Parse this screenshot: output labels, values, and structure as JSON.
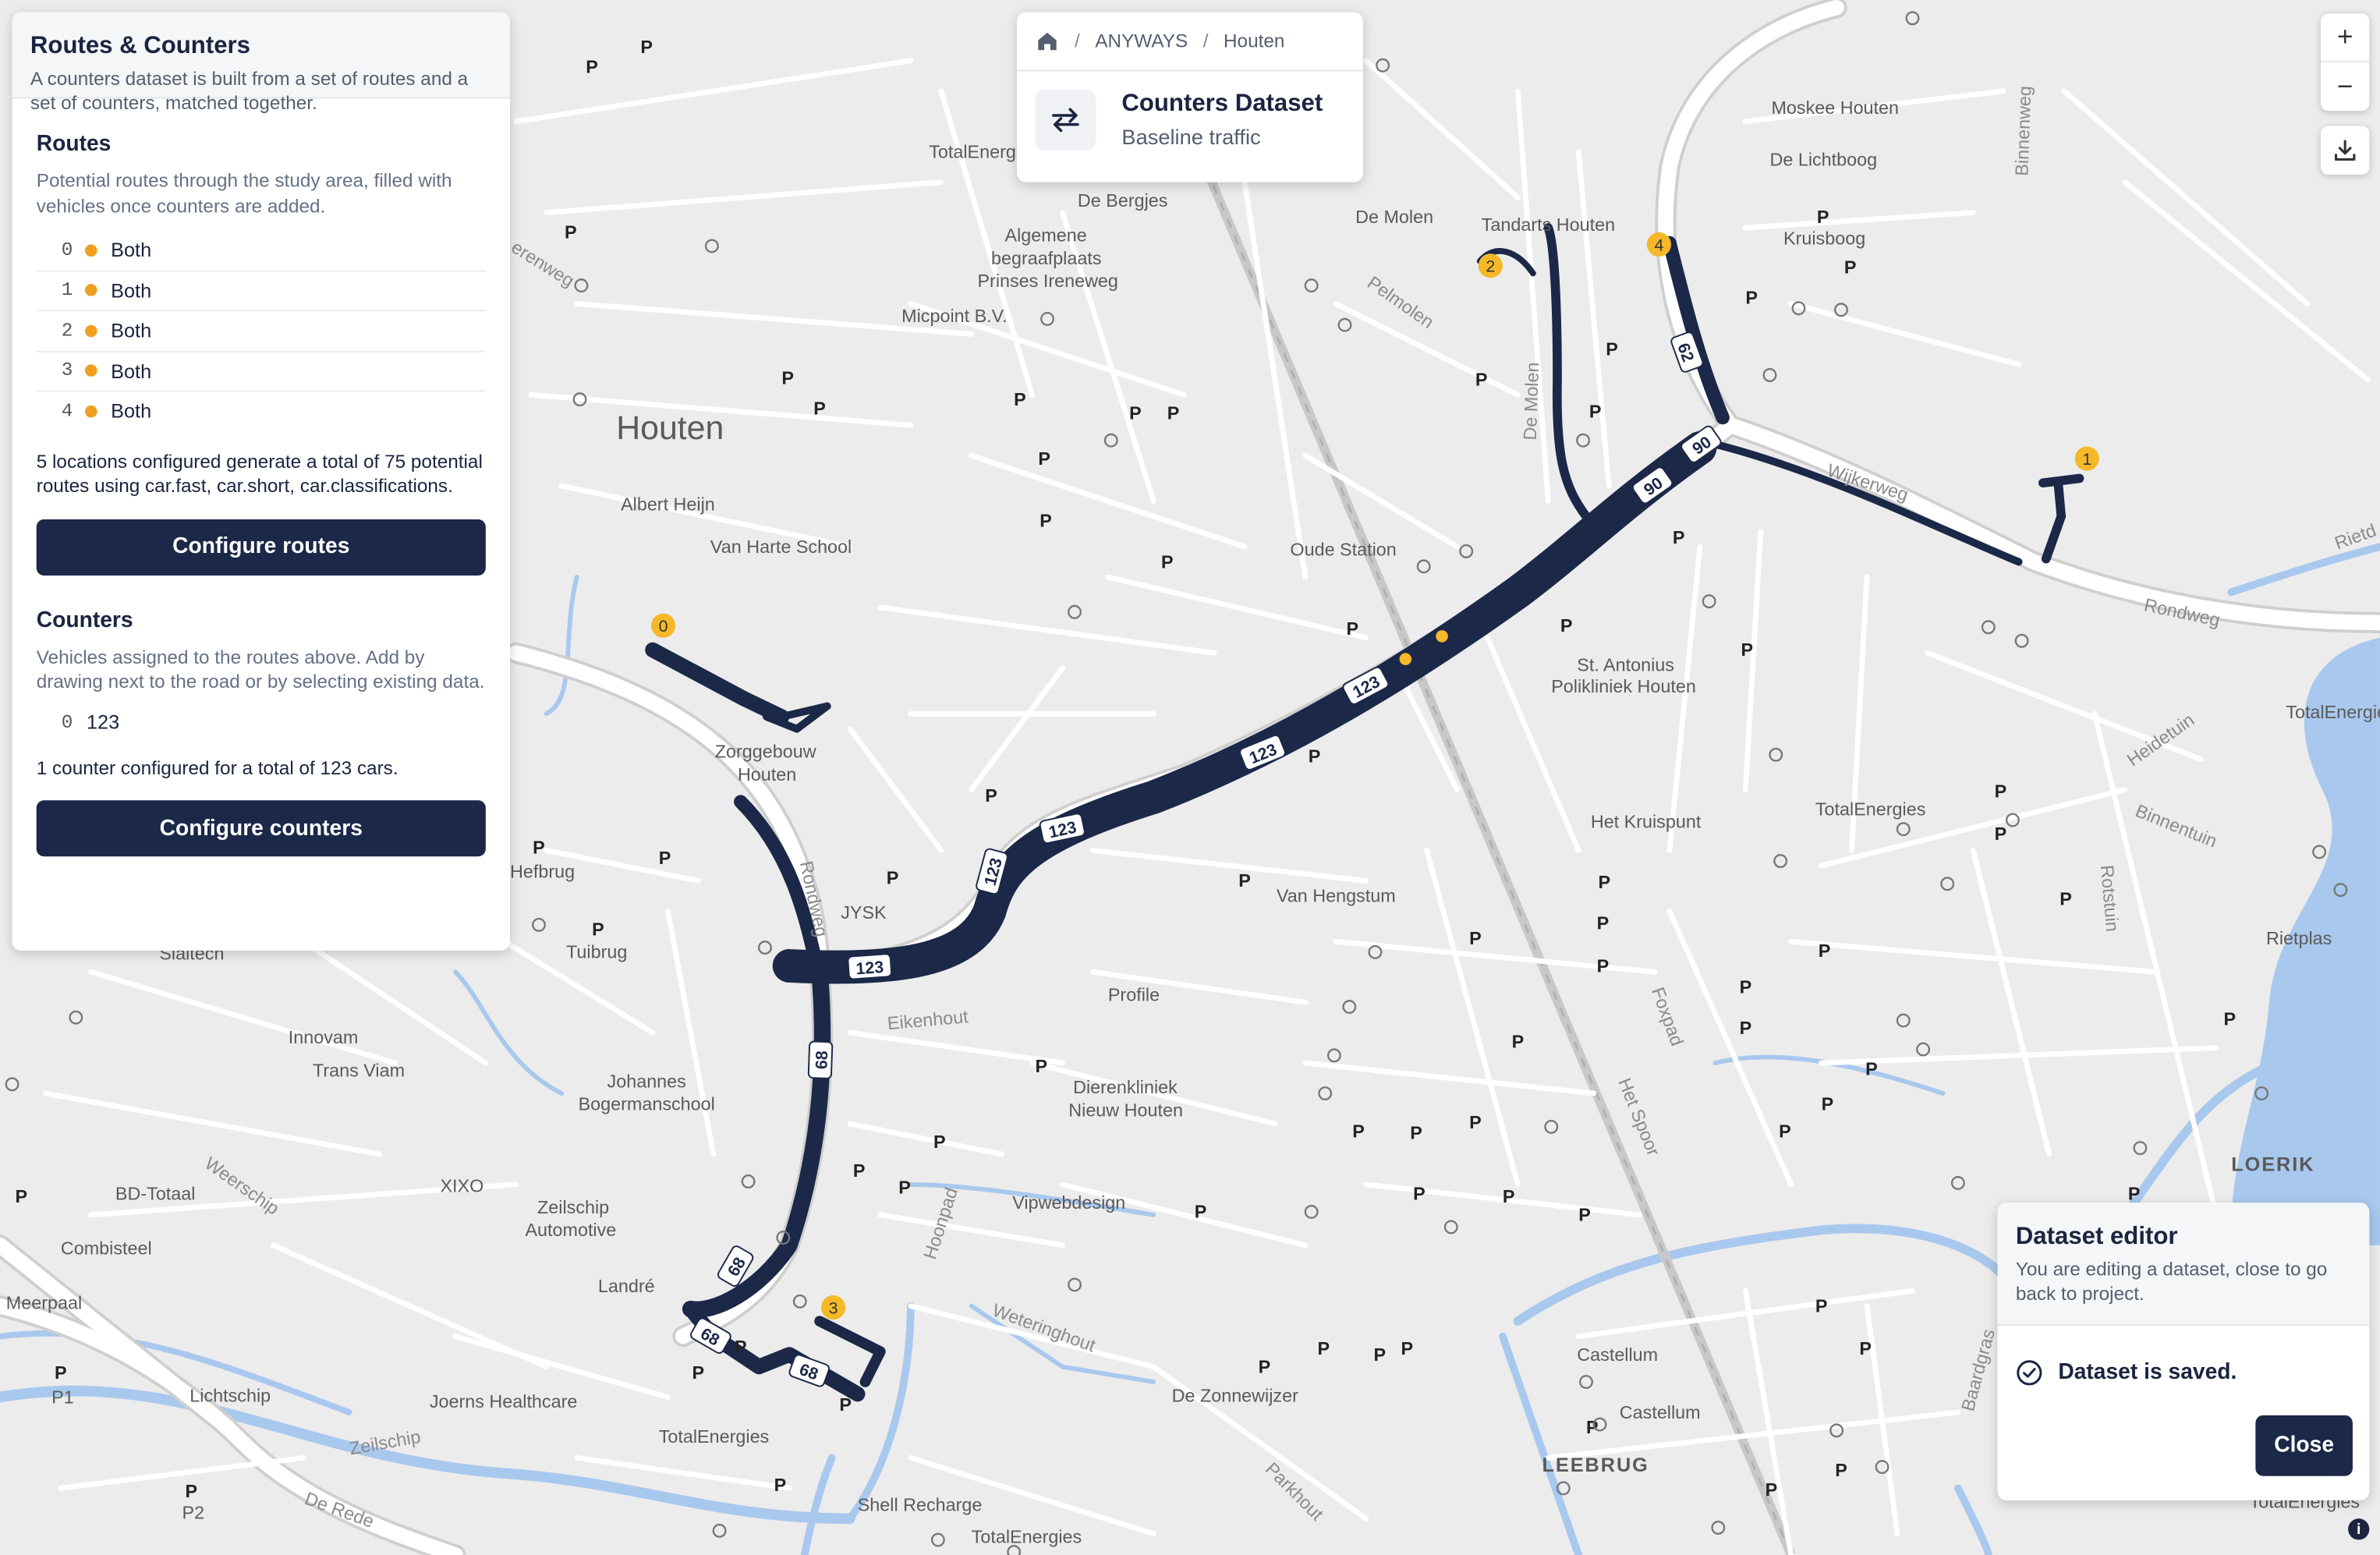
{
  "map": {
    "places": [
      {
        "text": "Houten",
        "size": 22,
        "color": "#3a3a3a"
      },
      {
        "text": "LOERIK",
        "size": 13,
        "color": "#7a4a4a"
      },
      {
        "text": "LEEBRUG",
        "size": 13,
        "color": "#7a4a4a"
      }
    ],
    "labels": [
      "TotalEnergies",
      "De Bergjes",
      "Algemene",
      "begraafplaats",
      "Prinses Ireneweg",
      "Micpoint B.V.",
      "Albert Heijn",
      "Van Harte School",
      "Zorggebouw",
      "Houten",
      "JYSK",
      "Van Hengstum",
      "Oude Station",
      "De Molen",
      "Tandarts Houten",
      "Moskee Houten",
      "De Lichtboog",
      "Kruisboog",
      "St. Antonius",
      "Polikliniek Houten",
      "Het Kruispunt",
      "TotalEnergies",
      "Rietplas",
      "Profile",
      "Dierenkliniek",
      "Nieuw Houten",
      "Johannes",
      "Bogermanschool",
      "Innovam",
      "Trans Viam",
      "Tuibrug",
      "Hefbrug",
      "Slaitech",
      "BD-Totaal",
      "XIXO",
      "Zeilschip",
      "Automotive",
      "Combisteel",
      "Landré",
      "Meerpaal",
      "Lichtschip",
      "Joerns Healthcare",
      "TotalEnergies",
      "Shell Recharge",
      "TotalEnergies",
      "Vipwebdesign",
      "De Zonnewijzer",
      "Castellum",
      "Castellum",
      "TotalEnergies",
      "TotalEnergies",
      "P1",
      "P2"
    ],
    "streets": [
      "Rondweg",
      "Wijkerweg",
      "Rondweg",
      "Binnenweg",
      "Heidetuin",
      "Binnentuin",
      "Rotstuin",
      "Foxpad",
      "Het Spoor",
      "Eikenhout",
      "Hoonpad",
      "Weteringhout",
      "Parkhout",
      "Zeilschip",
      "Weerschip",
      "De Rede",
      "Pelmolen",
      "De Molen",
      "Rietd",
      "Baardgras",
      "erenweg"
    ],
    "route_labels": [
      "123",
      "123",
      "123",
      "123",
      "123",
      "123",
      "90",
      "90",
      "62",
      "68",
      "68",
      "68",
      "68"
    ],
    "route_points": [
      "0",
      "1",
      "2",
      "3",
      "4"
    ],
    "colors": {
      "route": "#1b2848",
      "marker": "#f5b829",
      "water": "#a9c8ee",
      "road": "#ffffff",
      "land": "#ececec"
    }
  },
  "panel": {
    "title": "Routes & Counters",
    "subtitle": "A counters dataset is built from a set of routes and a set of counters, matched together.",
    "routes": {
      "title": "Routes",
      "description": "Potential routes through the study area, filled with vehicles once counters are added.",
      "items": [
        {
          "id": "0",
          "direction": "Both"
        },
        {
          "id": "1",
          "direction": "Both"
        },
        {
          "id": "2",
          "direction": "Both"
        },
        {
          "id": "3",
          "direction": "Both"
        },
        {
          "id": "4",
          "direction": "Both"
        }
      ],
      "summary": "5 locations configured generate a total of 75 potential routes using car.fast, car.short, car.classifications.",
      "button": "Configure routes"
    },
    "counters": {
      "title": "Counters",
      "description": "Vehicles assigned to the routes above. Add by drawing next to the road or by selecting existing data.",
      "items": [
        {
          "id": "0",
          "value": "123"
        }
      ],
      "summary": "1 counter configured for a total of 123 cars.",
      "button": "Configure counters"
    }
  },
  "breadcrumb": {
    "items": [
      "ANYWAYS",
      "Houten"
    ],
    "separator": "/",
    "dataset_title": "Counters Dataset",
    "dataset_subtitle": "Baseline traffic"
  },
  "controls": {
    "zoom_in": "+",
    "zoom_out": "−"
  },
  "editor": {
    "title": "Dataset editor",
    "description": "You are editing a dataset, close to go back to project.",
    "status": "Dataset is saved.",
    "close": "Close"
  },
  "info": "i"
}
